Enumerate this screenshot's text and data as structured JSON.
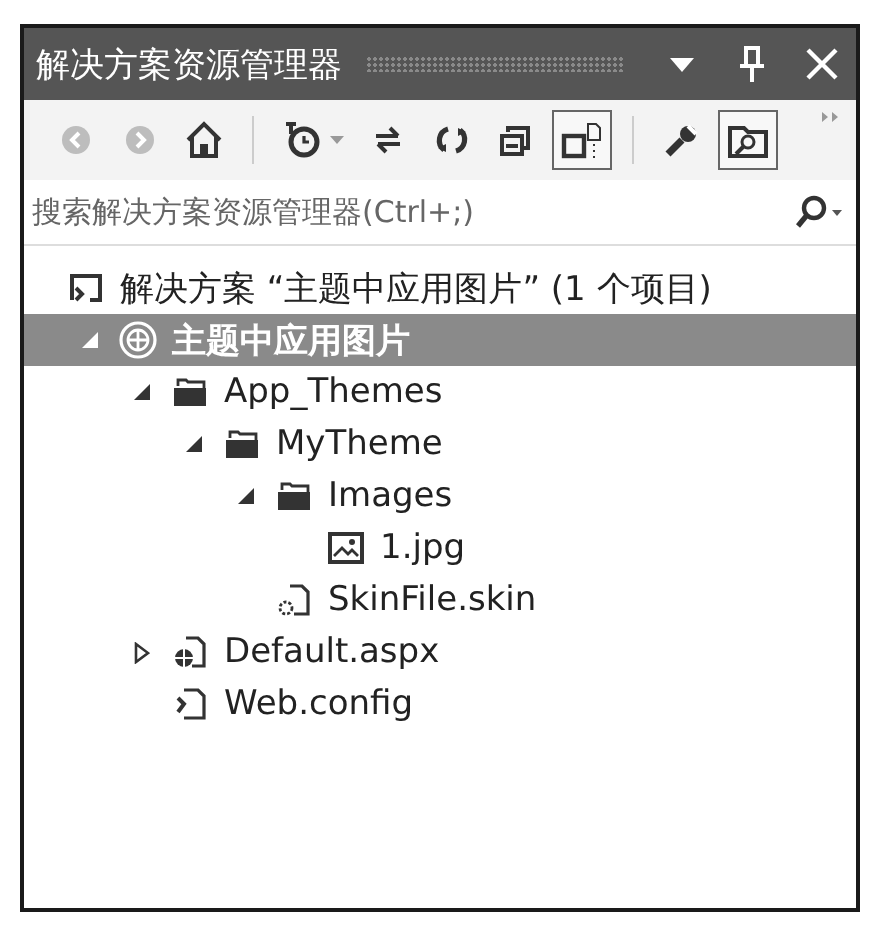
{
  "window": {
    "title": "解决方案资源管理器"
  },
  "toolbar": [
    {
      "kind": "back",
      "disabled": true,
      "pressed": false,
      "dropdown": false
    },
    {
      "kind": "forward",
      "disabled": true,
      "pressed": false,
      "dropdown": false
    },
    {
      "kind": "home",
      "disabled": false,
      "pressed": false,
      "dropdown": false
    },
    {
      "kind": "separator"
    },
    {
      "kind": "history",
      "disabled": false,
      "pressed": false,
      "dropdown": true
    },
    {
      "kind": "sync",
      "disabled": false,
      "pressed": false,
      "dropdown": false
    },
    {
      "kind": "refresh",
      "disabled": false,
      "pressed": false,
      "dropdown": false
    },
    {
      "kind": "collapse",
      "disabled": false,
      "pressed": false,
      "dropdown": false
    },
    {
      "kind": "show-all",
      "disabled": false,
      "pressed": true,
      "dropdown": false
    },
    {
      "kind": "separator"
    },
    {
      "kind": "properties",
      "disabled": false,
      "pressed": false,
      "dropdown": false
    },
    {
      "kind": "preview",
      "disabled": false,
      "pressed": true,
      "dropdown": false
    }
  ],
  "search": {
    "placeholder": "搜索解决方案资源管理器(Ctrl+;)"
  },
  "solution": {
    "label": "解决方案 “主题中应用图片” (1 个项目)"
  },
  "tree": [
    {
      "label": "主题中应用图片",
      "kind": "website",
      "selected": true,
      "expanded": true,
      "children": [
        {
          "label": "App_Themes",
          "kind": "folder",
          "selected": false,
          "expanded": true,
          "children": [
            {
              "label": "MyTheme",
              "kind": "folder",
              "selected": false,
              "expanded": true,
              "children": [
                {
                  "label": "Images",
                  "kind": "folder",
                  "selected": false,
                  "expanded": true,
                  "children": [
                    {
                      "label": "1.jpg",
                      "kind": "image",
                      "selected": false
                    }
                  ]
                },
                {
                  "label": "SkinFile.skin",
                  "kind": "skin",
                  "selected": false
                }
              ]
            }
          ]
        },
        {
          "label": "Default.aspx",
          "kind": "page",
          "selected": false,
          "expanded": false
        },
        {
          "label": "Web.config",
          "kind": "config",
          "selected": false
        }
      ]
    }
  ]
}
